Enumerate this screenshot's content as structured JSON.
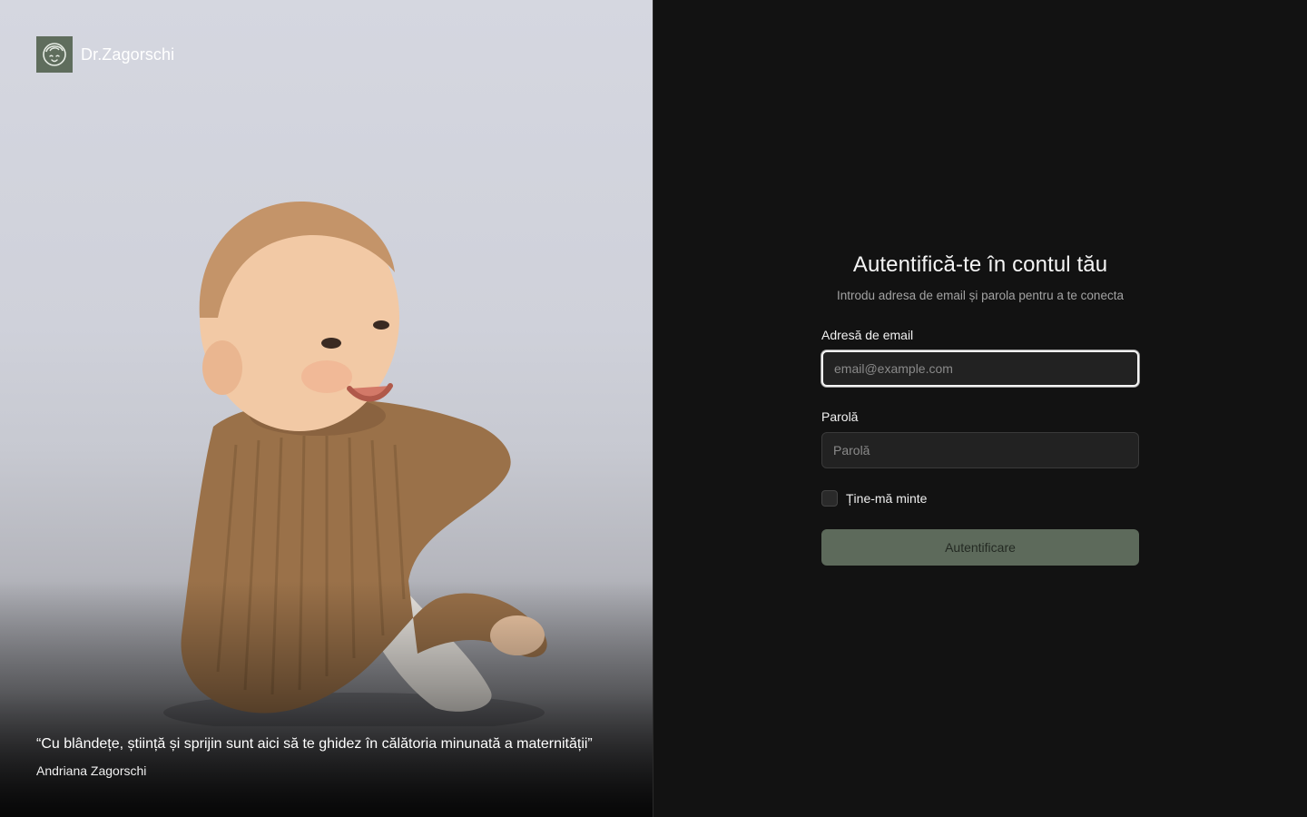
{
  "brand": {
    "name": "Dr.Zagorschi",
    "logo_icon": "face-logo-icon",
    "logo_color": "#5f6d5d"
  },
  "hero": {
    "image": "smiling-baby-photo",
    "quote": "“Cu blândețe, știință și sprijin sunt aici să te ghidez în călătoria minunată a maternității”",
    "author": "Andriana Zagorschi"
  },
  "login": {
    "title": "Autentifică-te în contul tău",
    "subtitle": "Introdu adresa de email și parola pentru a te conecta",
    "email_label": "Adresă de email",
    "email_placeholder": "email@example.com",
    "email_value": "",
    "password_label": "Parolă",
    "password_placeholder": "Parolă",
    "password_value": "",
    "remember_label": "Ține-mă minte",
    "remember_checked": false,
    "submit_label": "Autentificare",
    "accent_color": "#5d6a5b"
  }
}
